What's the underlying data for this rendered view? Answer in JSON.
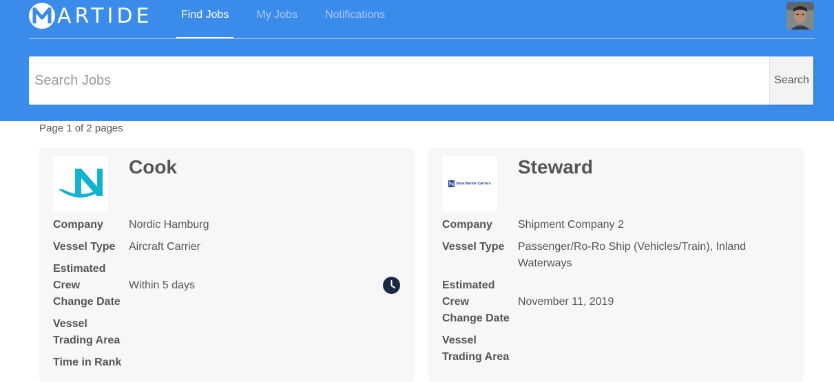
{
  "header": {
    "logo_letter": "M",
    "logo_text": "ARTIDE",
    "nav": [
      {
        "label": "Find Jobs",
        "active": true
      },
      {
        "label": "My Jobs",
        "active": false
      },
      {
        "label": "Notifications",
        "active": false
      }
    ]
  },
  "search": {
    "placeholder": "Search Jobs",
    "button_label": "Search"
  },
  "pagination": {
    "text": "Page 1 of 2 pages"
  },
  "jobs": [
    {
      "title": "Cook",
      "logo": "nordic-hamburg-logo",
      "fields": [
        {
          "label": "Company",
          "value": "Nordic Hamburg"
        },
        {
          "label": "Vessel Type",
          "value": "Aircraft Carrier"
        },
        {
          "label": "Estimated Crew Change Date",
          "value": "Within 5 days"
        },
        {
          "label": "Vessel Trading Area",
          "value": ""
        },
        {
          "label": "Time in Rank",
          "value": ""
        }
      ],
      "status_icon": "clock-icon"
    },
    {
      "title": "Steward",
      "logo_text": "Nova Marine Carriers",
      "fields": [
        {
          "label": "Company",
          "value": "Shipment Company 2"
        },
        {
          "label": "Vessel Type",
          "value": "Passenger/Ro-Ro Ship (Vehicles/Train), Inland Waterways"
        },
        {
          "label": "Estimated Crew Change Date",
          "value": "November 11, 2019"
        },
        {
          "label": "Vessel Trading Area",
          "value": ""
        }
      ]
    }
  ],
  "colors": {
    "header_bg": "#3b8beb",
    "card_bg": "#f7f7f7",
    "clock_icon": "#1b2a44",
    "nordic_logo": "#12b3d1"
  }
}
